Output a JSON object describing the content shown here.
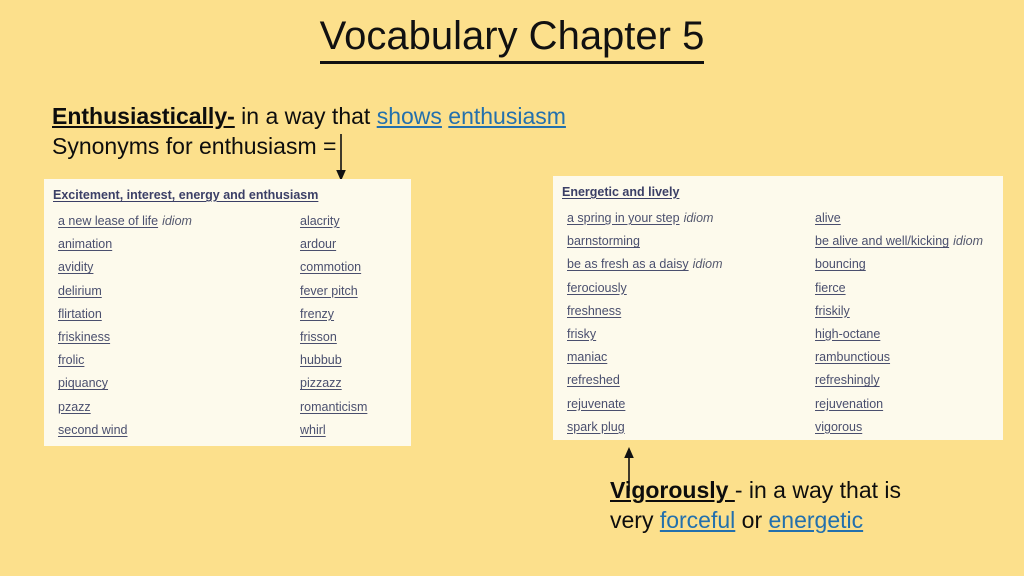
{
  "slide": {
    "title": "Vocabulary Chapter 5",
    "background_color": "#fce08c",
    "panel_color": "#fdfaec",
    "link_color": "#2370ad",
    "thesaurus_link_color": "#4a4f6e",
    "thesaurus_header_color": "#3b3f66"
  },
  "intro": {
    "term": "Enthusiastically-",
    "definition_text": " in a way that ",
    "link_1": "shows",
    "link_space": " ",
    "link_2": "enthusiasm",
    "line2": "Synonyms for enthusiasm ="
  },
  "bottom": {
    "term": "Vigorously ",
    "dash": "- ",
    "definition_text": "in a way that is",
    "line2_prefix": "very ",
    "link_1": "forceful",
    "line2_middle": " or ",
    "link_2": "energetic"
  },
  "left_panel": {
    "header": "Excitement, interest, energy and enthusiasm",
    "column_1": [
      {
        "word": "a new lease of life",
        "tag": "idiom"
      },
      {
        "word": "animation",
        "tag": ""
      },
      {
        "word": "avidity",
        "tag": ""
      },
      {
        "word": "delirium",
        "tag": ""
      },
      {
        "word": "flirtation",
        "tag": ""
      },
      {
        "word": "friskiness",
        "tag": ""
      },
      {
        "word": "frolic",
        "tag": ""
      },
      {
        "word": "piquancy",
        "tag": ""
      },
      {
        "word": "pzazz",
        "tag": ""
      },
      {
        "word": "second wind",
        "tag": ""
      }
    ],
    "column_2": [
      {
        "word": "alacrity",
        "tag": ""
      },
      {
        "word": "ardour",
        "tag": ""
      },
      {
        "word": "commotion",
        "tag": ""
      },
      {
        "word": "fever pitch",
        "tag": ""
      },
      {
        "word": "frenzy",
        "tag": ""
      },
      {
        "word": "frisson",
        "tag": ""
      },
      {
        "word": "hubbub",
        "tag": ""
      },
      {
        "word": "pizzazz",
        "tag": ""
      },
      {
        "word": "romanticism",
        "tag": ""
      },
      {
        "word": "whirl",
        "tag": ""
      }
    ]
  },
  "right_panel": {
    "header": "Energetic and lively",
    "column_1": [
      {
        "word": "a spring in your step",
        "tag": "idiom"
      },
      {
        "word": "barnstorming",
        "tag": ""
      },
      {
        "word": "be as fresh as a daisy",
        "tag": "idiom"
      },
      {
        "word": "ferociously",
        "tag": ""
      },
      {
        "word": "freshness",
        "tag": ""
      },
      {
        "word": "frisky",
        "tag": ""
      },
      {
        "word": "maniac",
        "tag": ""
      },
      {
        "word": "refreshed",
        "tag": ""
      },
      {
        "word": "rejuvenate",
        "tag": ""
      },
      {
        "word": "spark plug",
        "tag": ""
      }
    ],
    "column_2": [
      {
        "word": "alive",
        "tag": ""
      },
      {
        "word": "be alive and well/kicking",
        "tag": "idiom"
      },
      {
        "word": "bouncing",
        "tag": ""
      },
      {
        "word": "fierce",
        "tag": ""
      },
      {
        "word": "friskily",
        "tag": ""
      },
      {
        "word": "high-octane",
        "tag": ""
      },
      {
        "word": "rambunctious",
        "tag": ""
      },
      {
        "word": "refreshingly",
        "tag": ""
      },
      {
        "word": "rejuvenation",
        "tag": ""
      },
      {
        "word": "vigorous",
        "tag": ""
      }
    ]
  }
}
